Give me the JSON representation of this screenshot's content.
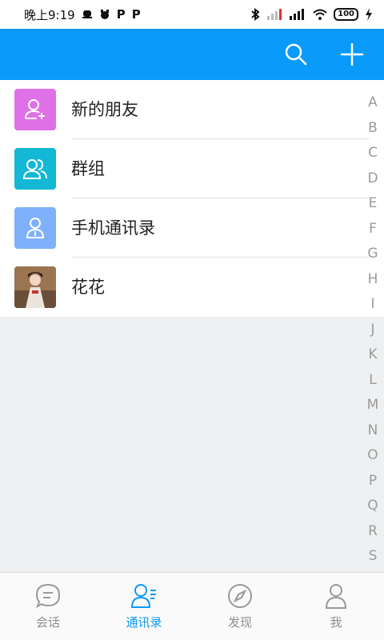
{
  "status_bar": {
    "time": "晚上9:19",
    "left_icons": [
      "notification-icon-1",
      "notification-icon-2",
      "p-icon-1",
      "p-icon-2"
    ],
    "p_glyph": "P",
    "battery": "100"
  },
  "app_bar": {
    "color": "#0a9afa",
    "actions": [
      "search-icon",
      "plus-icon"
    ]
  },
  "contacts": {
    "items": [
      {
        "label": "新的朋友",
        "icon": "add-user-icon",
        "color": "#e070e8"
      },
      {
        "label": "群组",
        "icon": "group-icon",
        "color": "#12b8d6"
      },
      {
        "label": "手机通讯录",
        "icon": "phone-contacts-icon",
        "color": "#7fb0fc"
      },
      {
        "label": "花花",
        "icon": "avatar-photo",
        "color": "#8a6a4e"
      }
    ]
  },
  "index_bar": {
    "letters": [
      "A",
      "B",
      "C",
      "D",
      "E",
      "F",
      "G",
      "H",
      "I",
      "J",
      "K",
      "L",
      "M",
      "N",
      "O",
      "P",
      "Q",
      "R",
      "S"
    ]
  },
  "bottom_nav": {
    "tabs": [
      {
        "label": "会话",
        "icon": "chat-icon",
        "active": false
      },
      {
        "label": "通讯录",
        "icon": "contacts-icon",
        "active": true
      },
      {
        "label": "发现",
        "icon": "compass-icon",
        "active": false
      },
      {
        "label": "我",
        "icon": "profile-icon",
        "active": false
      }
    ],
    "active_color": "#0a9afa",
    "inactive_color": "#8f8f8f"
  }
}
